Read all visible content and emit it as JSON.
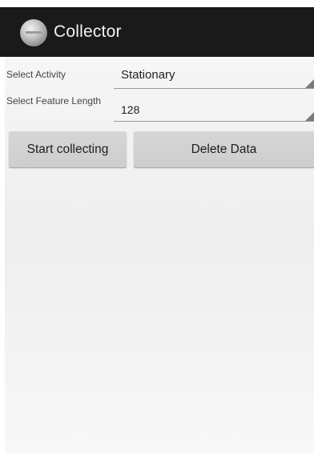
{
  "action_bar": {
    "title": "Collector",
    "icon": "app-logo-icon"
  },
  "form": {
    "activity": {
      "label": "Select Activity",
      "value": "Stationary"
    },
    "feature_length": {
      "label": "Select Feature Length",
      "value": "128"
    }
  },
  "buttons": {
    "start_label": "Start collecting",
    "delete_label": "Delete Data"
  },
  "colors": {
    "action_bar_bg": "#1a1a1a",
    "action_bar_text": "#f2f2f2",
    "button_bg": "#d2d2d2",
    "content_bg": "#f2f2f2"
  }
}
